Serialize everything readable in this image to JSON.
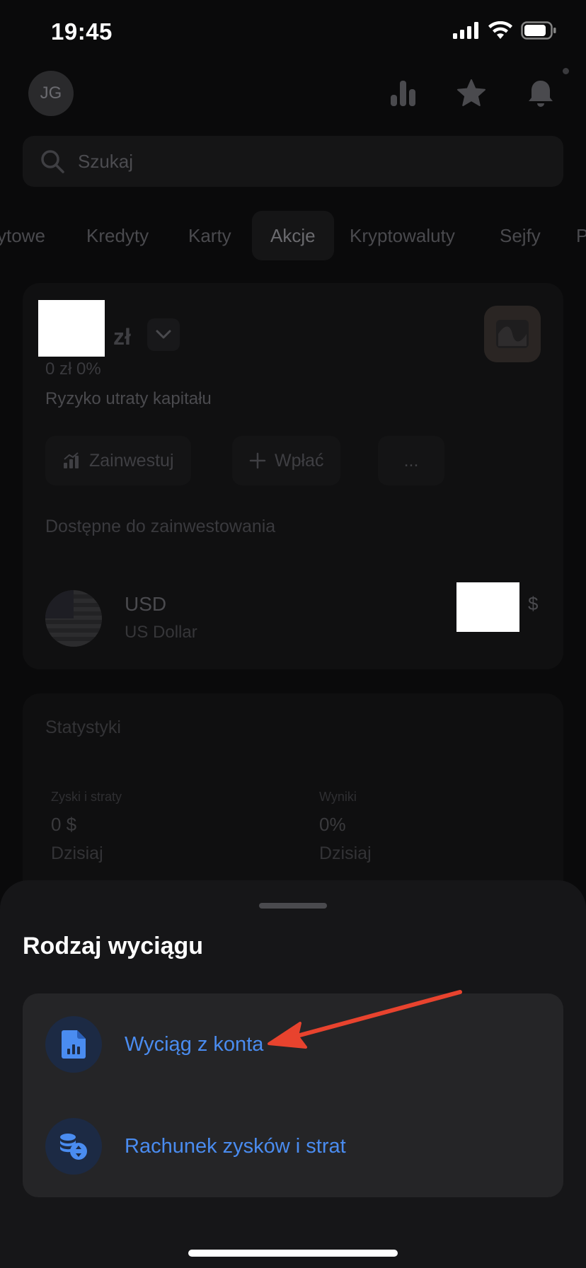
{
  "status_bar": {
    "time": "19:45"
  },
  "header": {
    "avatar_initials": "JG"
  },
  "search": {
    "placeholder": "Szukaj"
  },
  "tabs": [
    "ytowe",
    "Kredyty",
    "Karty",
    "Akcje",
    "Kryptowaluty",
    "Sejfy",
    "P"
  ],
  "active_tab": "Akcje",
  "account": {
    "currency_suffix": "zł",
    "change": "0 zł 0%",
    "risk_note": "Ryzyko utraty kapitału",
    "actions": [
      "Zainwestuj",
      "Wpłać",
      "..."
    ],
    "available_title": "Dostępne do zainwestowania",
    "holding": {
      "code": "USD",
      "name": "US Dollar",
      "currency_symbol": "$"
    }
  },
  "stats": {
    "title": "Statystyki",
    "items": [
      {
        "label": "Zyski i straty",
        "value": "0 $",
        "period": "Dzisiaj"
      },
      {
        "label": "Wyniki",
        "value": "0%",
        "period": "Dzisiaj"
      }
    ]
  },
  "sheet": {
    "title": "Rodzaj wyciągu",
    "options": [
      {
        "label": "Wyciąg z konta",
        "icon": "document-chart-icon"
      },
      {
        "label": "Rachunek zysków i strat",
        "icon": "coins-exchange-icon"
      }
    ]
  },
  "colors": {
    "accent": "#4a8cf0",
    "annotation_arrow": "#e8432e"
  }
}
